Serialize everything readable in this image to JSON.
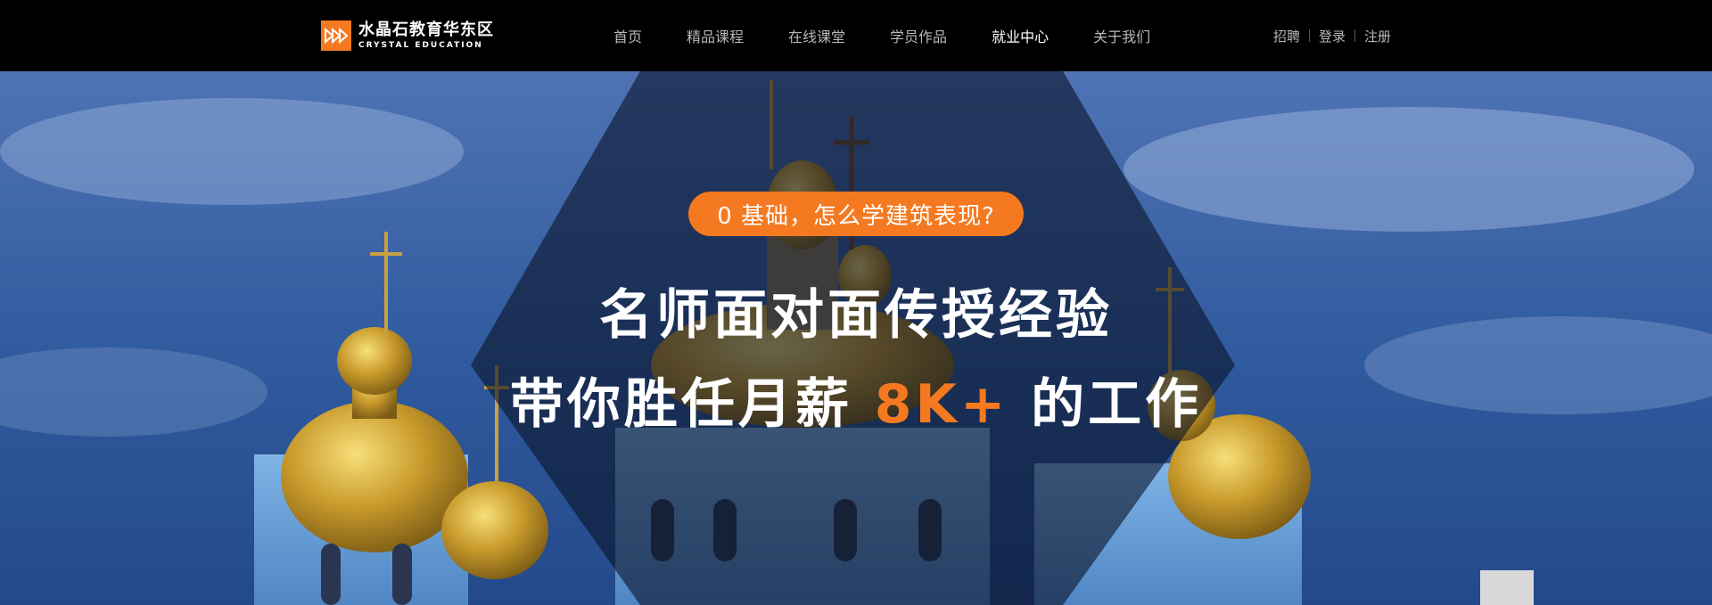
{
  "brand": {
    "name_cn": "水晶石教育华东区",
    "name_en": "CRYSTAL EDUCATION",
    "logo_icon": "triple-play-arrows-icon",
    "accent_color": "#f47920"
  },
  "nav": {
    "items": [
      {
        "label": "首页",
        "active": false
      },
      {
        "label": "精品课程",
        "active": false
      },
      {
        "label": "在线课堂",
        "active": false
      },
      {
        "label": "学员作品",
        "active": false
      },
      {
        "label": "就业中心",
        "active": true
      },
      {
        "label": "关于我们",
        "active": false
      }
    ]
  },
  "user_links": {
    "recruit": "招聘",
    "login": "登录",
    "register": "注册"
  },
  "hero": {
    "badge": "0 基础，怎么学建筑表现?",
    "line1": "名师面对面传授经验",
    "line2_prefix": "带你胜任月薪 ",
    "line2_highlight": "8K+",
    "line2_suffix": " 的工作"
  }
}
